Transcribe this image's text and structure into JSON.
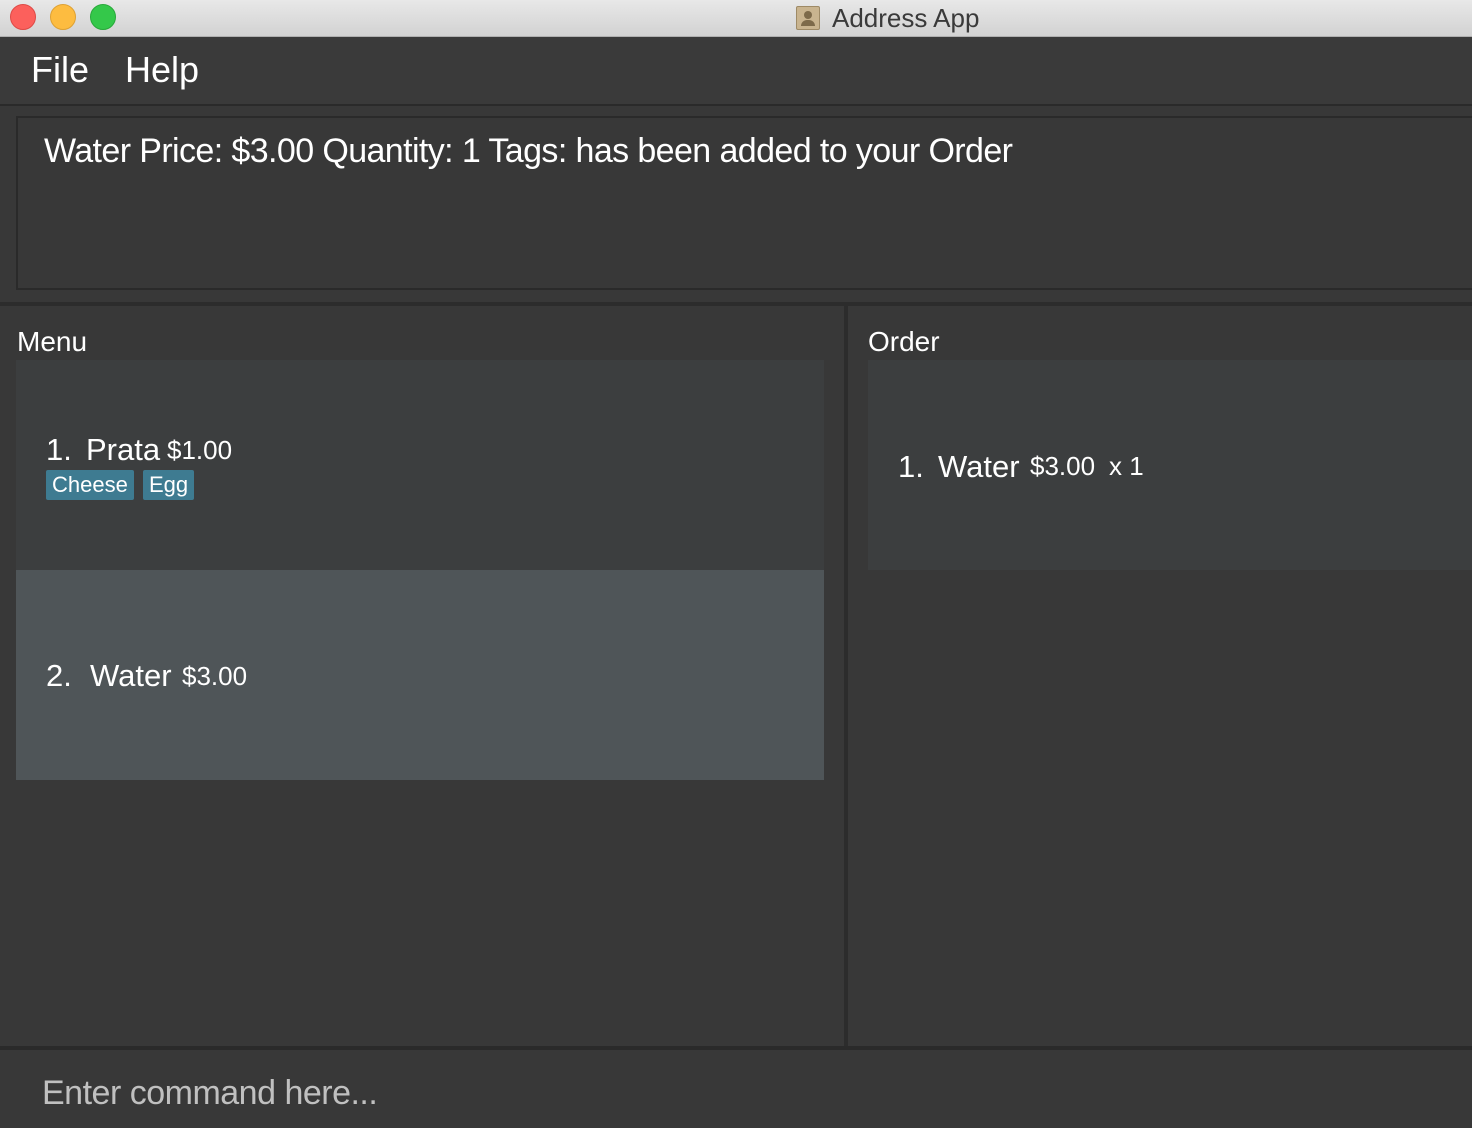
{
  "window": {
    "title": "Address App"
  },
  "menubar": {
    "file": "File",
    "help": "Help"
  },
  "result": {
    "message": "Water Price: $3.00 Quantity: 1 Tags:  has been added to your Order"
  },
  "menu_panel": {
    "label": "Menu",
    "items": [
      {
        "index": "1.",
        "name": "Prata",
        "price": "$1.00",
        "tags": [
          "Cheese",
          "Egg"
        ],
        "selected": false
      },
      {
        "index": "2.",
        "name": "Water",
        "price": "$3.00",
        "tags": [],
        "selected": true
      }
    ]
  },
  "order_panel": {
    "label": "Order",
    "items": [
      {
        "index": "1.",
        "name": "Water",
        "price": "$3.00",
        "quantity": "x 1"
      }
    ]
  },
  "command": {
    "placeholder": "Enter command here...",
    "value": ""
  },
  "colors": {
    "background": "#383838",
    "card": "#3c3e3f",
    "card_selected": "#4f5558",
    "tag": "#3e7b91"
  }
}
